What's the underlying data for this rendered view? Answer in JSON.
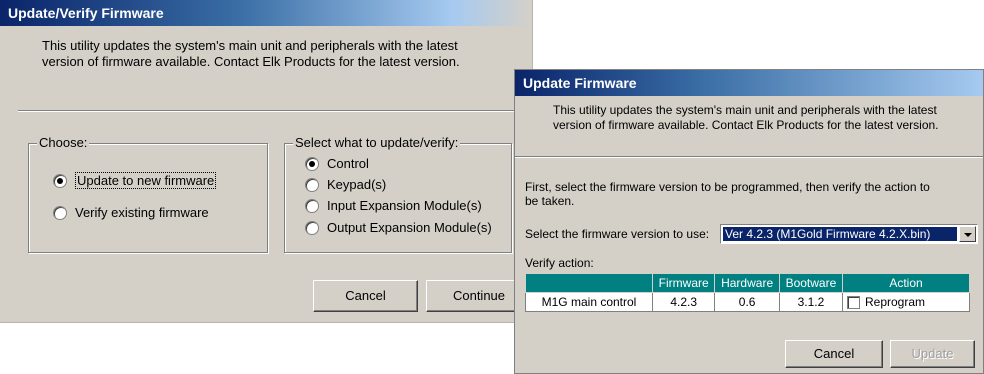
{
  "dialog1": {
    "title": "Update/Verify Firmware",
    "intro_line1": "This utility updates the system's main unit and peripherals with the latest",
    "intro_line2": "version of firmware available.  Contact Elk Products for the latest version.",
    "choose": {
      "label": "Choose:",
      "options": [
        "Update to new firmware",
        "Verify existing firmware"
      ],
      "selected": "Update to new firmware"
    },
    "select_what": {
      "label": "Select what to update/verify:",
      "options": [
        "Control",
        "Keypad(s)",
        "Input Expansion Module(s)",
        "Output Expansion Module(s)"
      ],
      "selected": "Control"
    },
    "cancel_label": "Cancel",
    "continue_label": "Continue"
  },
  "dialog2": {
    "title": "Update Firmware",
    "intro_line1": "This utility updates the system's main unit and peripherals with the latest",
    "intro_line2": "version of firmware available.  Contact Elk Products for the latest version.",
    "instruction_line1": "First, select the firmware version to be programmed, then verify the action to",
    "instruction_line2": "be taken.",
    "version_label": "Select the firmware version to use:",
    "version_value": "Ver 4.2.3 (M1Gold Firmware 4.2.X.bin)",
    "verify_label": "Verify action:",
    "table": {
      "columns": [
        "",
        "Firmware",
        "Hardware",
        "Bootware",
        "Action"
      ],
      "rows": [
        {
          "name": "M1G main control",
          "firmware": "4.2.3",
          "hardware": "0.6",
          "bootware": "3.1.2",
          "action": "Reprogram",
          "checked": false
        }
      ]
    },
    "cancel_label": "Cancel",
    "update_label": "Update"
  }
}
